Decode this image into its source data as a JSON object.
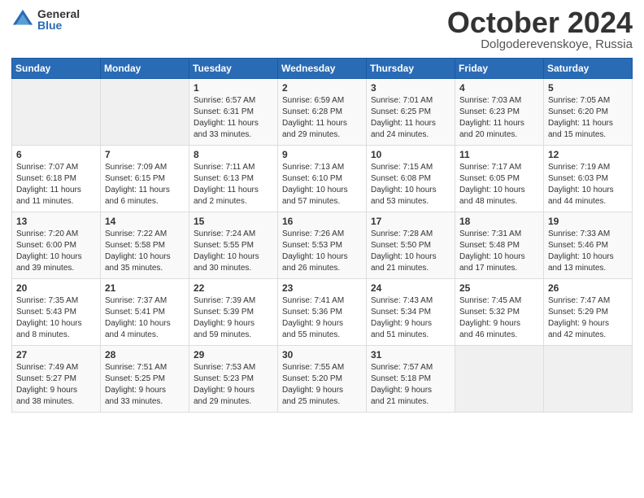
{
  "logo": {
    "general": "General",
    "blue": "Blue"
  },
  "title": {
    "month": "October 2024",
    "location": "Dolgoderevenskoye, Russia"
  },
  "headers": [
    "Sunday",
    "Monday",
    "Tuesday",
    "Wednesday",
    "Thursday",
    "Friday",
    "Saturday"
  ],
  "weeks": [
    [
      {
        "day": "",
        "info": ""
      },
      {
        "day": "",
        "info": ""
      },
      {
        "day": "1",
        "info": "Sunrise: 6:57 AM\nSunset: 6:31 PM\nDaylight: 11 hours\nand 33 minutes."
      },
      {
        "day": "2",
        "info": "Sunrise: 6:59 AM\nSunset: 6:28 PM\nDaylight: 11 hours\nand 29 minutes."
      },
      {
        "day": "3",
        "info": "Sunrise: 7:01 AM\nSunset: 6:25 PM\nDaylight: 11 hours\nand 24 minutes."
      },
      {
        "day": "4",
        "info": "Sunrise: 7:03 AM\nSunset: 6:23 PM\nDaylight: 11 hours\nand 20 minutes."
      },
      {
        "day": "5",
        "info": "Sunrise: 7:05 AM\nSunset: 6:20 PM\nDaylight: 11 hours\nand 15 minutes."
      }
    ],
    [
      {
        "day": "6",
        "info": "Sunrise: 7:07 AM\nSunset: 6:18 PM\nDaylight: 11 hours\nand 11 minutes."
      },
      {
        "day": "7",
        "info": "Sunrise: 7:09 AM\nSunset: 6:15 PM\nDaylight: 11 hours\nand 6 minutes."
      },
      {
        "day": "8",
        "info": "Sunrise: 7:11 AM\nSunset: 6:13 PM\nDaylight: 11 hours\nand 2 minutes."
      },
      {
        "day": "9",
        "info": "Sunrise: 7:13 AM\nSunset: 6:10 PM\nDaylight: 10 hours\nand 57 minutes."
      },
      {
        "day": "10",
        "info": "Sunrise: 7:15 AM\nSunset: 6:08 PM\nDaylight: 10 hours\nand 53 minutes."
      },
      {
        "day": "11",
        "info": "Sunrise: 7:17 AM\nSunset: 6:05 PM\nDaylight: 10 hours\nand 48 minutes."
      },
      {
        "day": "12",
        "info": "Sunrise: 7:19 AM\nSunset: 6:03 PM\nDaylight: 10 hours\nand 44 minutes."
      }
    ],
    [
      {
        "day": "13",
        "info": "Sunrise: 7:20 AM\nSunset: 6:00 PM\nDaylight: 10 hours\nand 39 minutes."
      },
      {
        "day": "14",
        "info": "Sunrise: 7:22 AM\nSunset: 5:58 PM\nDaylight: 10 hours\nand 35 minutes."
      },
      {
        "day": "15",
        "info": "Sunrise: 7:24 AM\nSunset: 5:55 PM\nDaylight: 10 hours\nand 30 minutes."
      },
      {
        "day": "16",
        "info": "Sunrise: 7:26 AM\nSunset: 5:53 PM\nDaylight: 10 hours\nand 26 minutes."
      },
      {
        "day": "17",
        "info": "Sunrise: 7:28 AM\nSunset: 5:50 PM\nDaylight: 10 hours\nand 21 minutes."
      },
      {
        "day": "18",
        "info": "Sunrise: 7:31 AM\nSunset: 5:48 PM\nDaylight: 10 hours\nand 17 minutes."
      },
      {
        "day": "19",
        "info": "Sunrise: 7:33 AM\nSunset: 5:46 PM\nDaylight: 10 hours\nand 13 minutes."
      }
    ],
    [
      {
        "day": "20",
        "info": "Sunrise: 7:35 AM\nSunset: 5:43 PM\nDaylight: 10 hours\nand 8 minutes."
      },
      {
        "day": "21",
        "info": "Sunrise: 7:37 AM\nSunset: 5:41 PM\nDaylight: 10 hours\nand 4 minutes."
      },
      {
        "day": "22",
        "info": "Sunrise: 7:39 AM\nSunset: 5:39 PM\nDaylight: 9 hours\nand 59 minutes."
      },
      {
        "day": "23",
        "info": "Sunrise: 7:41 AM\nSunset: 5:36 PM\nDaylight: 9 hours\nand 55 minutes."
      },
      {
        "day": "24",
        "info": "Sunrise: 7:43 AM\nSunset: 5:34 PM\nDaylight: 9 hours\nand 51 minutes."
      },
      {
        "day": "25",
        "info": "Sunrise: 7:45 AM\nSunset: 5:32 PM\nDaylight: 9 hours\nand 46 minutes."
      },
      {
        "day": "26",
        "info": "Sunrise: 7:47 AM\nSunset: 5:29 PM\nDaylight: 9 hours\nand 42 minutes."
      }
    ],
    [
      {
        "day": "27",
        "info": "Sunrise: 7:49 AM\nSunset: 5:27 PM\nDaylight: 9 hours\nand 38 minutes."
      },
      {
        "day": "28",
        "info": "Sunrise: 7:51 AM\nSunset: 5:25 PM\nDaylight: 9 hours\nand 33 minutes."
      },
      {
        "day": "29",
        "info": "Sunrise: 7:53 AM\nSunset: 5:23 PM\nDaylight: 9 hours\nand 29 minutes."
      },
      {
        "day": "30",
        "info": "Sunrise: 7:55 AM\nSunset: 5:20 PM\nDaylight: 9 hours\nand 25 minutes."
      },
      {
        "day": "31",
        "info": "Sunrise: 7:57 AM\nSunset: 5:18 PM\nDaylight: 9 hours\nand 21 minutes."
      },
      {
        "day": "",
        "info": ""
      },
      {
        "day": "",
        "info": ""
      }
    ]
  ]
}
